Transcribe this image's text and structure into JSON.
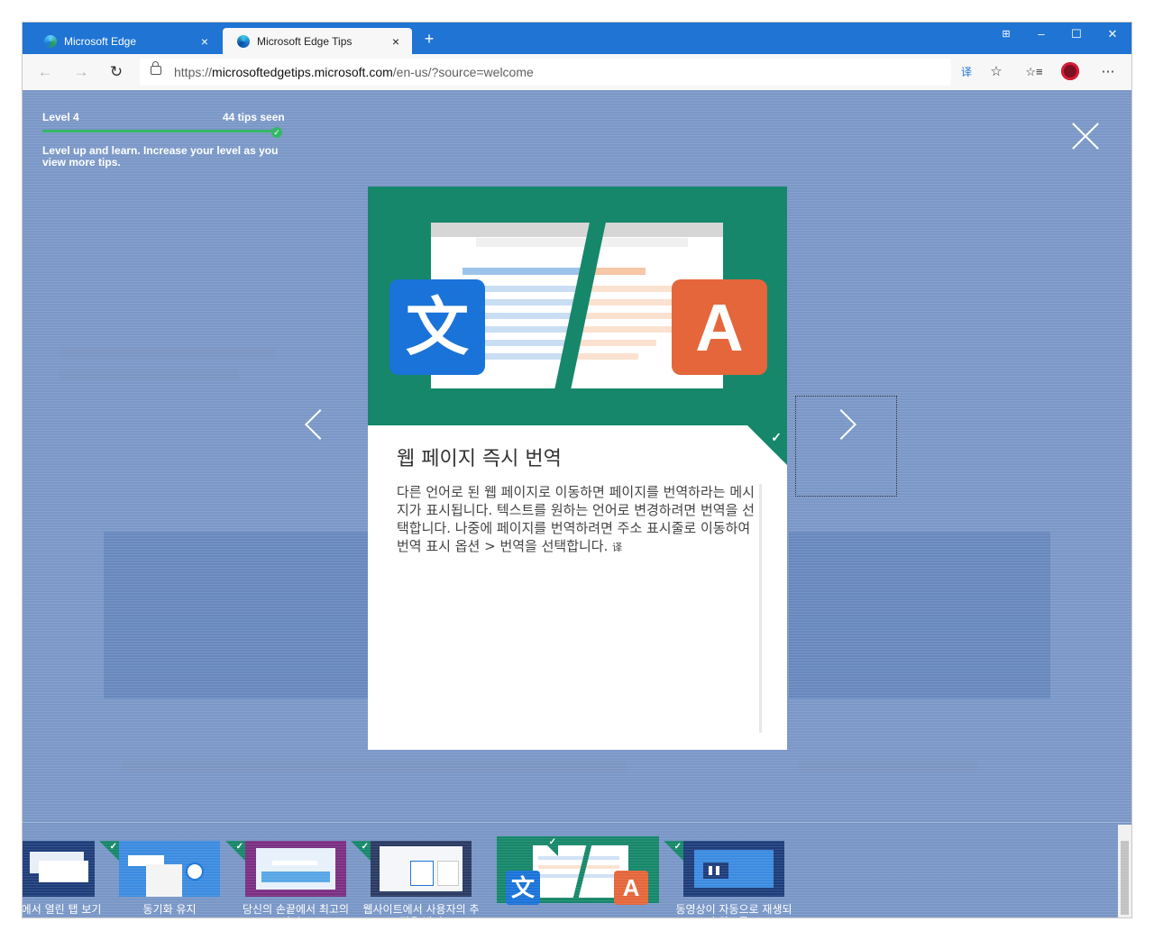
{
  "browser": {
    "tabs": [
      {
        "label": "Microsoft Edge",
        "close": "×"
      },
      {
        "label": "Microsoft Edge Tips",
        "close": "×"
      }
    ],
    "new_tab": "+",
    "window_controls": {
      "minimize": "–",
      "maximize": "☐",
      "close": "✕",
      "tab_actions": "⊞"
    },
    "nav": {
      "back": "←",
      "forward": "→",
      "refresh": "↻"
    },
    "url_prefix": "https://",
    "url_host": "microsoftedgetips.microsoft.com",
    "url_path": "/en-us/?source=welcome",
    "toolbar": {
      "translate": "译",
      "favorite": "☆",
      "favorites_list": "☆≡",
      "more": "⋯"
    }
  },
  "tips": {
    "level": "Level 4",
    "tips_seen": "44 tips seen",
    "level_note": "Level up and learn. Increase your level as you view more tips.",
    "progress": 1.0,
    "card": {
      "title": "웹 페이지 즉시 번역",
      "description": "다른 언어로 된 웹 페이지로 이동하면 페이지를 번역하라는 메시지가 표시됩니다. 텍스트를 원하는 언어로 변경하려면 번역을 선택합니다. 나중에 페이지를 번역하려면 주소 표시줄로 이동하여 번역 표시 옵션 > 번역을 선택합니다.",
      "hero_left_glyph": "文",
      "hero_right_glyph": "A"
    },
    "thumbnails": [
      {
        "label": "전체에서 열린 탭 보기"
      },
      {
        "label": "동기화 유지"
      },
      {
        "label": "당신의 손끝에서 최고의 사이트"
      },
      {
        "label": "웹사이트에서 사용자의 추적을 방지"
      },
      {
        "label": "",
        "selected": true
      },
      {
        "label": "동영상이 자동으로 재생되지 않도록 ..."
      }
    ]
  },
  "colors": {
    "chrome_blue": "#1f74d4",
    "overlay": "#7a97c7",
    "tip_green": "#16876a",
    "translate_blue": "#1a73d8",
    "translate_orange": "#e4663a"
  }
}
